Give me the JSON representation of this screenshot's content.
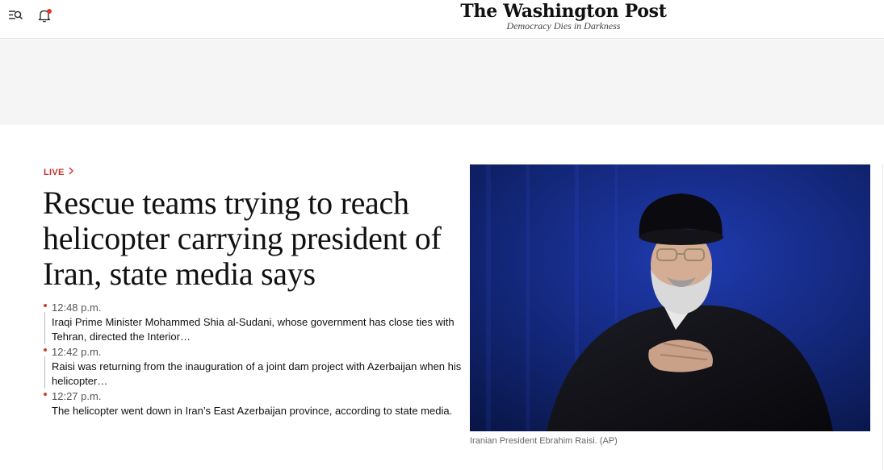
{
  "header": {
    "logo_text": "The Washington Post",
    "tagline": "Democracy Dies in Darkness",
    "menu_icon": "search-menu-icon",
    "bell_icon": "bell-icon",
    "notification_color": "#e03b2a"
  },
  "story": {
    "live_label": "LIVE",
    "live_icon": "chevron-right-icon",
    "live_color": "#c9302c",
    "headline": "Rescue teams trying to reach helicopter carrying president of Iran, state media says",
    "updates": [
      {
        "time": "12:48 p.m.",
        "text": "Iraqi Prime Minister Mohammed Shia al-Sudani, whose government has close ties with Tehran, directed the Interior…"
      },
      {
        "time": "12:42 p.m.",
        "text": "Raisi was returning from the inauguration of a joint dam project with Azerbaijan when his helicopter…"
      },
      {
        "time": "12:27 p.m.",
        "text": "The helicopter went down in Iran’s East Azerbaijan province, according to state media."
      }
    ]
  },
  "photo": {
    "caption": "Iranian President Ebrahim Raisi. (AP)"
  }
}
